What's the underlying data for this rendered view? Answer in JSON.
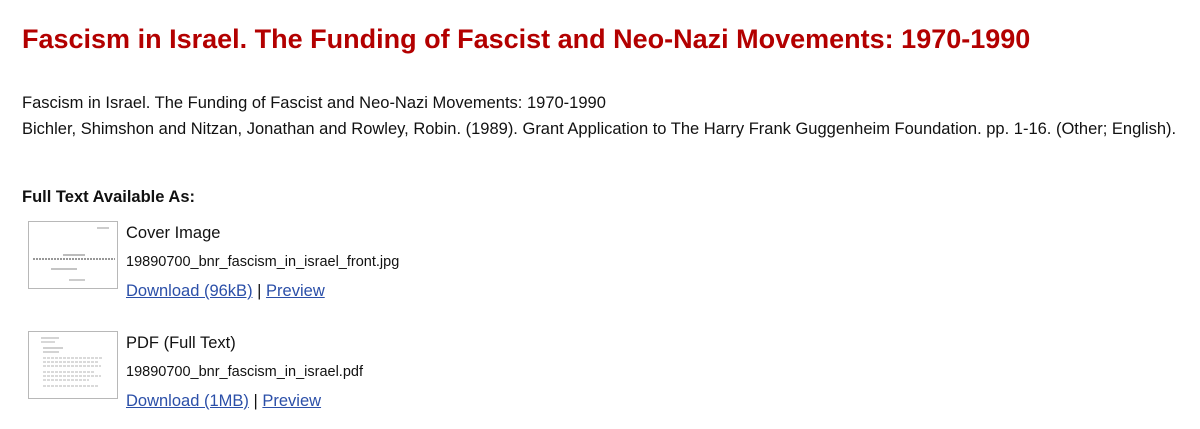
{
  "page": {
    "title": "Fascism in Israel. The Funding of Fascist and Neo-Nazi Movements: 1970-1990"
  },
  "citation": {
    "title_line": "Fascism in Israel. The Funding of Fascist and Neo-Nazi Movements: 1970-1990",
    "reference": "Bichler, Shimshon and Nitzan, Jonathan and Rowley, Robin. (1989). Grant Application to The Harry Frank Guggenheim Foundation. pp. 1-16. (Other; English)."
  },
  "fulltext": {
    "heading": "Full Text Available As:",
    "documents": [
      {
        "type": "Cover Image",
        "filename": "19890700_bnr_fascism_in_israel_front.jpg",
        "download_label": "Download (96kB)",
        "separator": "|",
        "preview_label": "Preview",
        "thumbnail_icon": "cover-page-thumbnail"
      },
      {
        "type": "PDF (Full Text)",
        "filename": "19890700_bnr_fascism_in_israel.pdf",
        "download_label": "Download (1MB)",
        "separator": "|",
        "preview_label": "Preview",
        "thumbnail_icon": "pdf-page-thumbnail"
      }
    ]
  },
  "colors": {
    "title": "#b30000",
    "link": "#2b4fa8",
    "text": "#111111"
  }
}
